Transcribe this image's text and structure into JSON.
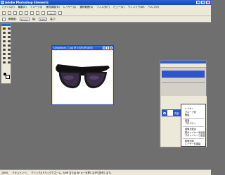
{
  "app": {
    "title": "Adobe Photoshop Elements"
  },
  "menu": [
    "ファイル(F)",
    "編集(E)",
    "イメージ(I)",
    "画質調整(N)",
    "レイヤー(L)",
    "選択範囲(S)",
    "フィルタ(T)",
    "ビュー(V)",
    "ウィンドウ(W)",
    "ヘルプ(H)"
  ],
  "toolbar": {
    "field_label": "ヘルプ",
    "zoom_field": "100%"
  },
  "options_bar": {
    "label_a": "解像度:",
    "value_a": "Screen",
    "label_b": "幅:",
    "label_c": "高さ:"
  },
  "document": {
    "title": "sunglasses_1.jpg @ 100%(RGB/8)"
  },
  "layers": {
    "layer_name": "背景"
  },
  "context_menu": {
    "items": [
      "レイヤー",
      "グループ化",
      "削除",
      "複製",
      "プロパティ",
      "画像を統合",
      "表示レイヤーを結合",
      "下のレイヤーと結合",
      "新規作成",
      "レイヤーを複製"
    ]
  },
  "status": {
    "zoom": "100%",
    "doc_info": "ドキュメント:",
    "hint": "クリック&ドラッグでズーム。Shift または Alt キーを押しながら操作します。"
  },
  "colors": {
    "accent": "#2c62d6",
    "workspace": "#6f6f70",
    "selection": "#2f55c8"
  }
}
